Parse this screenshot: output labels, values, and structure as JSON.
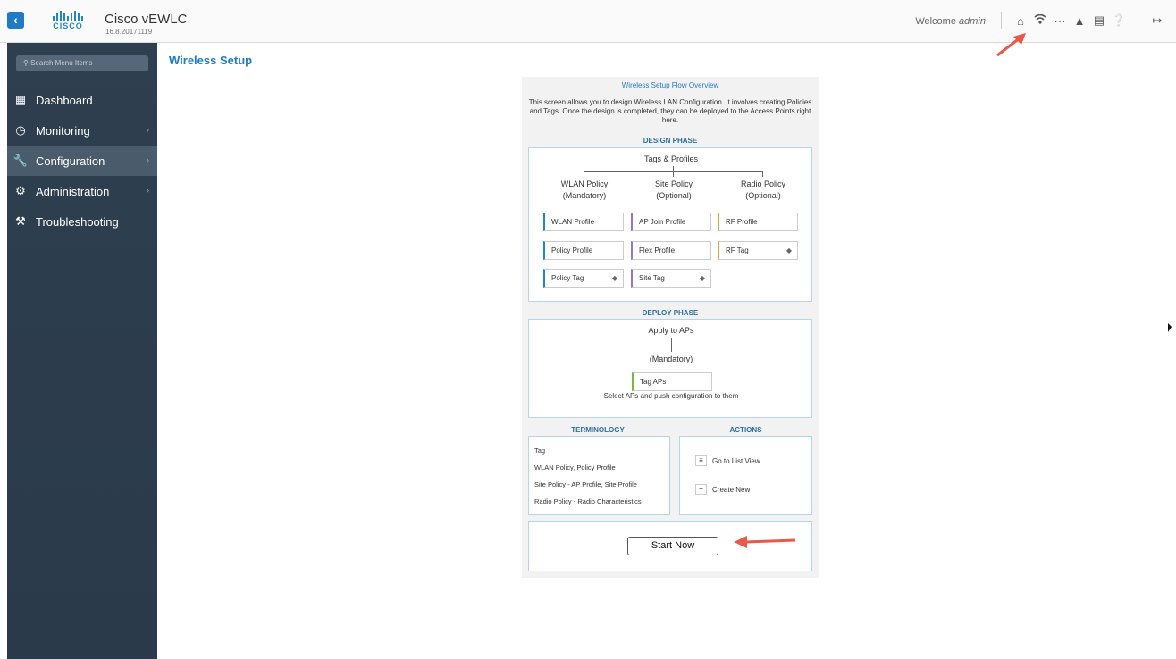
{
  "header": {
    "back_icon": "back-arrow-icon",
    "logo_text": "CISCO",
    "app_title": "Cisco vEWLC",
    "app_version": "16.8.20171119",
    "welcome_prefix": "Welcome",
    "username": "admin",
    "icons": [
      "home-icon",
      "wireless-setup-icon",
      "more-icon",
      "alert-icon",
      "clipboard-icon",
      "help-icon",
      "logout-icon"
    ]
  },
  "sidebar": {
    "search_placeholder": "Search Menu Items",
    "items": [
      {
        "label": "Dashboard",
        "icon": "dashboard-icon",
        "has_submenu": false,
        "active": false
      },
      {
        "label": "Monitoring",
        "icon": "monitoring-icon",
        "has_submenu": true,
        "active": false
      },
      {
        "label": "Configuration",
        "icon": "wrench-icon",
        "has_submenu": true,
        "active": true
      },
      {
        "label": "Administration",
        "icon": "gear-icon",
        "has_submenu": true,
        "active": false
      },
      {
        "label": "Troubleshooting",
        "icon": "tools-icon",
        "has_submenu": false,
        "active": false
      }
    ]
  },
  "main": {
    "page_title": "Wireless Setup",
    "overview_title": "Wireless Setup Flow Overview",
    "overview_desc": "This screen allows you to design Wireless LAN Configuration. It involves creating Policies and Tags. Once the design is completed, they can be deployed to the Access Points right here.",
    "design": {
      "heading": "DESIGN PHASE",
      "root": "Tags & Profiles",
      "columns": [
        {
          "title": "WLAN Policy",
          "subtitle": "(Mandatory)",
          "chips": [
            "WLAN Profile",
            "Policy Profile",
            "Policy Tag"
          ]
        },
        {
          "title": "Site Policy",
          "subtitle": "(Optional)",
          "chips": [
            "AP Join Profile",
            "Flex Profile",
            "Site Tag"
          ]
        },
        {
          "title": "Radio Policy",
          "subtitle": "(Optional)",
          "chips": [
            "RF Profile",
            "RF Tag"
          ]
        }
      ]
    },
    "deploy": {
      "heading": "DEPLOY PHASE",
      "title": "Apply to APs",
      "subtitle": "(Mandatory)",
      "chip": "Tag APs",
      "note": "Select APs and push configuration to them"
    },
    "terminology": {
      "heading": "TERMINOLOGY",
      "lines": [
        "Tag",
        "WLAN Policy, Policy Profile",
        "Site Policy - AP Profile, Site Profile",
        "Radio Policy - Radio Characteristics"
      ]
    },
    "actions": {
      "heading": "ACTIONS",
      "items": [
        {
          "label": "Go to List View",
          "icon": "list-icon"
        },
        {
          "label": "Create New",
          "icon": "plus-icon"
        }
      ]
    },
    "start_button": "Start Now"
  },
  "colors": {
    "accent": "#1e7bc4",
    "sidebar_bg": "#2e3f4f",
    "annotation_arrow": "#e8594a"
  }
}
